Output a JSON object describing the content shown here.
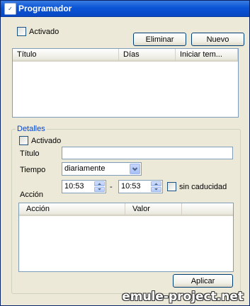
{
  "window": {
    "title": "Programador",
    "icon": "scheduler-app-icon"
  },
  "top": {
    "activated_label": "Activado",
    "delete_label": "Eliminar",
    "new_label": "Nuevo",
    "columns": [
      "Título",
      "Días",
      "Iniciar tem..."
    ]
  },
  "details": {
    "group_title": "Detalles",
    "activated_label": "Activado",
    "title_label": "Título",
    "title_value": "",
    "time_label": "Tiempo",
    "time_value": "diariamente",
    "start_time": "10:53",
    "dash": "-",
    "end_time": "10:53",
    "no_expiry_label": "sin caducidad",
    "action_label": "Acción",
    "action_columns": [
      "Acción",
      "Valor"
    ],
    "apply_label": "Aplicar"
  },
  "watermark": "emule-project.net"
}
